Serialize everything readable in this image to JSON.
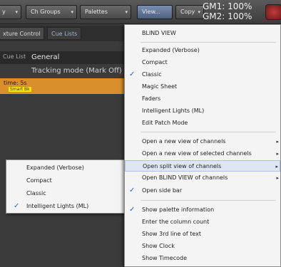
{
  "toolbar": {
    "y_btn_label": "y",
    "ch_groups_label": "Ch Groups",
    "palettes_label": "Palettes",
    "view_label": "View...",
    "copy_label": "Copy",
    "gm1": "GM1: 100%",
    "gm2": "GM2: 100%"
  },
  "left": {
    "tab_fixture": "xture Control",
    "tab_cue_lists": "Cue Lists",
    "cue_list_label": "Cue List",
    "cue_list_value": "General",
    "tracking_mode": "Tracking mode (Mark Off)",
    "cue_time": "time: 5s",
    "cue_tag": "Smart Bk"
  },
  "submenu": {
    "items": [
      {
        "label": "Expanded (Verbose)",
        "checked": false
      },
      {
        "label": "Compact",
        "checked": false
      },
      {
        "label": "Classic",
        "checked": false
      },
      {
        "label": "Intelligent Lights (ML)",
        "checked": true
      }
    ]
  },
  "menu": {
    "items": [
      {
        "label": "BLIND VIEW",
        "checked": false,
        "has_sub": false
      },
      {
        "label": "Expanded (Verbose)",
        "checked": false,
        "has_sub": false
      },
      {
        "label": "Compact",
        "checked": false,
        "has_sub": false
      },
      {
        "label": "Classic",
        "checked": true,
        "has_sub": false
      },
      {
        "label": "Magic Sheet",
        "checked": false,
        "has_sub": false
      },
      {
        "label": "Faders",
        "checked": false,
        "has_sub": false
      },
      {
        "label": "Intelligent Lights (ML)",
        "checked": false,
        "has_sub": false
      },
      {
        "label": "Edit Patch Mode",
        "checked": false,
        "has_sub": false
      },
      {
        "label": "Open a new view of channels",
        "checked": false,
        "has_sub": true
      },
      {
        "label": "Open a new view of selected channels",
        "checked": false,
        "has_sub": true
      },
      {
        "label": "Open split view of channels",
        "checked": false,
        "has_sub": true
      },
      {
        "label": "Open BLIND VIEW of channels",
        "checked": false,
        "has_sub": true
      },
      {
        "label": "Open side bar",
        "checked": true,
        "has_sub": false
      },
      {
        "label": "Show palette information",
        "checked": true,
        "has_sub": false
      },
      {
        "label": "Enter the column count",
        "checked": false,
        "has_sub": false
      },
      {
        "label": "Show 3rd line of text",
        "checked": false,
        "has_sub": false
      },
      {
        "label": "Show Clock",
        "checked": false,
        "has_sub": false
      },
      {
        "label": "Show Timecode",
        "checked": false,
        "has_sub": false
      }
    ],
    "check_glyph": "✓",
    "arrow_glyph": "▸"
  }
}
